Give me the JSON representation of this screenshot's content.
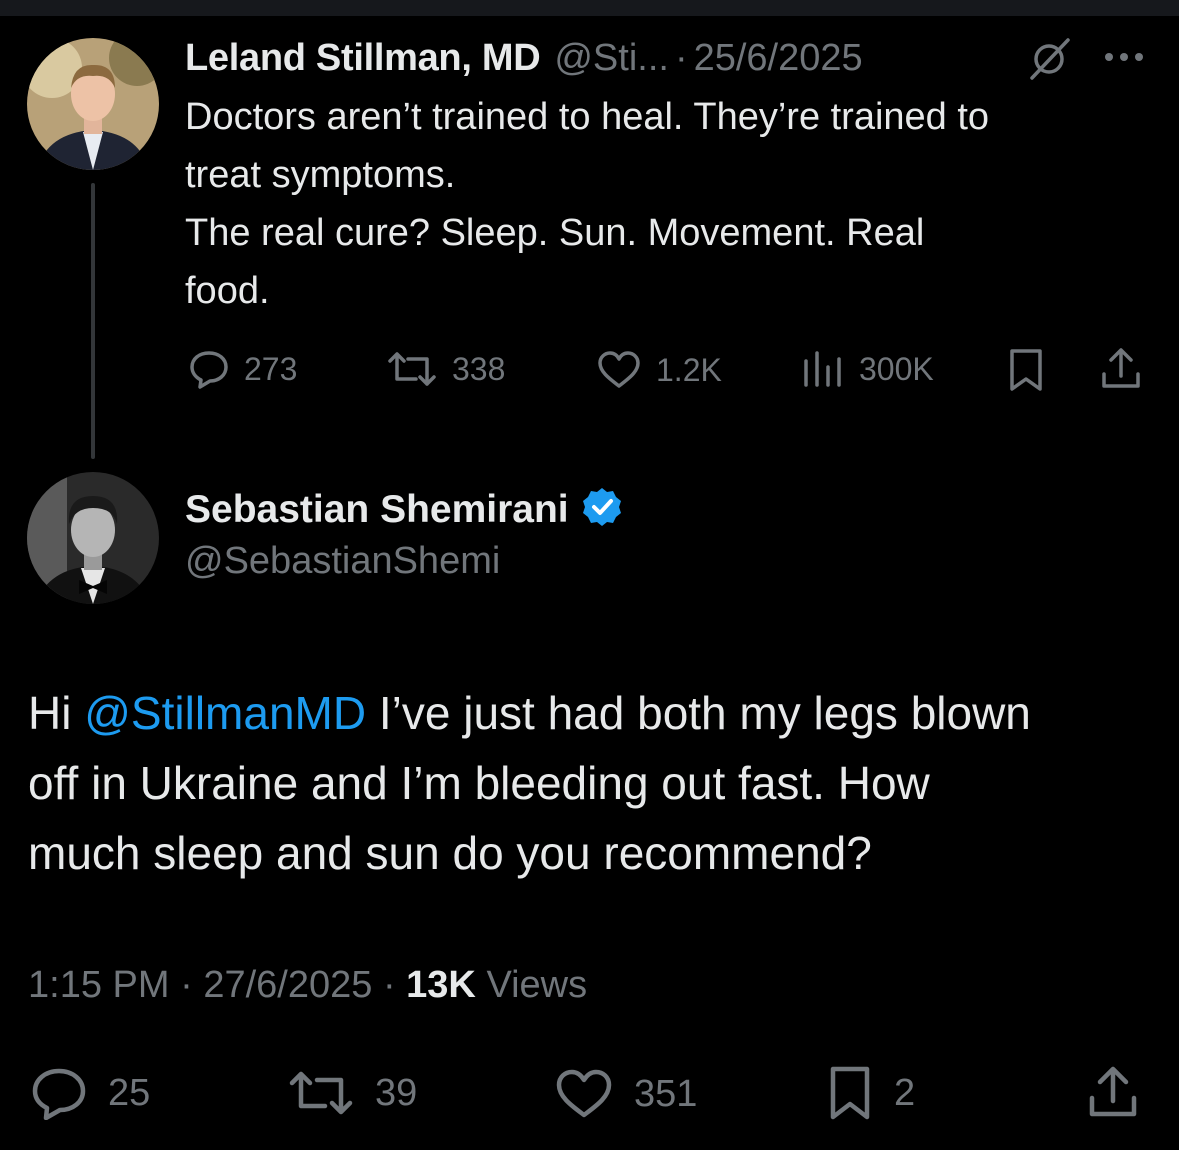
{
  "tweet1": {
    "author_name": "Leland Stillman, MD",
    "handle": "@Sti...",
    "separator": "·",
    "date": "25/6/2025",
    "text_lines": [
      "Doctors aren’t trained to heal. They’re trained to",
      "treat symptoms.",
      "The real cure? Sleep. Sun. Movement. Real",
      "food."
    ],
    "actions": {
      "replies": "273",
      "reposts": "338",
      "likes": "1.2K",
      "views": "300K"
    }
  },
  "tweet2": {
    "author_name": "Sebastian Shemirani",
    "handle": "@SebastianShemi",
    "text_prefix": "Hi ",
    "mention": "@StillmanMD",
    "text_line1_rest": " I’ve just had both my legs blown",
    "text_line2": "off in Ukraine and I’m bleeding out fast. How",
    "text_line3": "much sleep and sun do you recommend?",
    "time": "1:15 PM",
    "date": "27/6/2025",
    "separator": "·",
    "views_count": "13K",
    "views_label": "Views",
    "actions": {
      "replies": "25",
      "reposts": "39",
      "likes": "351",
      "bookmarks": "2"
    }
  },
  "colors": {
    "background": "#000000",
    "text": "#e7e9ea",
    "muted": "#71767b",
    "link": "#1d9bf0",
    "verified": "#1d9bf0"
  },
  "icons": [
    "grok-icon",
    "more-icon",
    "reply-icon",
    "repost-icon",
    "like-icon",
    "views-icon",
    "bookmark-icon",
    "share-icon",
    "verified-icon"
  ]
}
